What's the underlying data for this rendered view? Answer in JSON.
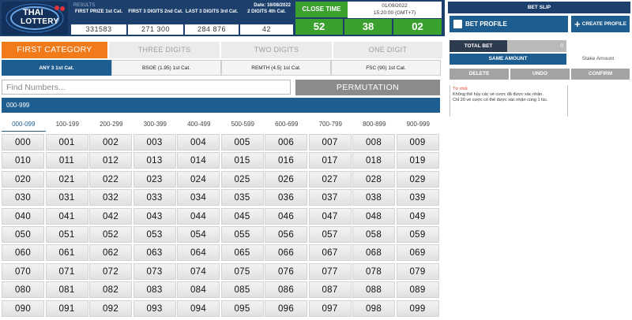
{
  "header": {
    "logo": {
      "line1": "THAI",
      "line2": "LOTTERY"
    },
    "results_label": "RESULTS",
    "results_date": "Date: 16/08/2022",
    "prizes": [
      {
        "title": "FIRST PRIZE 1st Cat.",
        "value": "331583"
      },
      {
        "title": "FIRST 3 DIGITS 2nd Cat.",
        "value": "271  300"
      },
      {
        "title": "LAST 3 DIGITS 3rd Cat.",
        "value": "284  876"
      },
      {
        "title": "2 DIGITS 4th Cat.",
        "value": "42"
      }
    ],
    "close_time": {
      "label": "CLOSE TIME",
      "date": "01/09/2022",
      "time": "15:20:00 (GMT+7)",
      "countdown": [
        "52",
        "38",
        "02"
      ]
    }
  },
  "category_tabs": [
    {
      "label": "FIRST CATEGORY",
      "active": true
    },
    {
      "label": "THREE DIGITS",
      "active": false
    },
    {
      "label": "TWO DIGITS",
      "active": false
    },
    {
      "label": "ONE DIGIT",
      "active": false
    }
  ],
  "sub_tabs": [
    {
      "label": "ANY 3 1st Cat.",
      "active": true
    },
    {
      "label": "BSOE (1.95) 1st Cat.",
      "active": false
    },
    {
      "label": "REMTH (4.5) 1st Cat.",
      "active": false
    },
    {
      "label": "FSC (90) 1st Cat.",
      "active": false
    }
  ],
  "search": {
    "placeholder": "Find Numbers...",
    "value": ""
  },
  "permutation_button": "PERMUTATION",
  "range_bar_label": "000-999",
  "range_tabs": [
    {
      "label": "000-099",
      "active": true
    },
    {
      "label": "100-199",
      "active": false
    },
    {
      "label": "200-299",
      "active": false
    },
    {
      "label": "300-399",
      "active": false
    },
    {
      "label": "400-499",
      "active": false
    },
    {
      "label": "500-599",
      "active": false
    },
    {
      "label": "600-699",
      "active": false
    },
    {
      "label": "700-799",
      "active": false
    },
    {
      "label": "800-899",
      "active": false
    },
    {
      "label": "900-999",
      "active": false
    }
  ],
  "numbers": [
    [
      "000",
      "001",
      "002",
      "003",
      "004",
      "005",
      "006",
      "007",
      "008",
      "009"
    ],
    [
      "010",
      "011",
      "012",
      "013",
      "014",
      "015",
      "016",
      "017",
      "018",
      "019"
    ],
    [
      "020",
      "021",
      "022",
      "023",
      "024",
      "025",
      "026",
      "027",
      "028",
      "029"
    ],
    [
      "030",
      "031",
      "032",
      "033",
      "034",
      "035",
      "036",
      "037",
      "038",
      "039"
    ],
    [
      "040",
      "041",
      "042",
      "043",
      "044",
      "045",
      "046",
      "047",
      "048",
      "049"
    ],
    [
      "050",
      "051",
      "052",
      "053",
      "054",
      "055",
      "056",
      "057",
      "058",
      "059"
    ],
    [
      "060",
      "061",
      "062",
      "063",
      "064",
      "065",
      "066",
      "067",
      "068",
      "069"
    ],
    [
      "070",
      "071",
      "072",
      "073",
      "074",
      "075",
      "076",
      "077",
      "078",
      "079"
    ],
    [
      "080",
      "081",
      "082",
      "083",
      "084",
      "085",
      "086",
      "087",
      "088",
      "089"
    ],
    [
      "090",
      "091",
      "092",
      "093",
      "094",
      "095",
      "096",
      "097",
      "098",
      "099"
    ]
  ],
  "bet_slip": {
    "title": "BET SLIP",
    "bet_profile_label": "BET PROFILE",
    "create_profile_label": "CREATE PROFILE",
    "total_bet_label": "TOTAL BET",
    "total_bet_value": "0",
    "same_amount_label": "SAME AMOUNT",
    "stake_amount_label": "Stake Amount",
    "delete_label": "DELETE",
    "undo_label": "UNDO",
    "confirm_label": "CONFIRM",
    "notice_title": "Từ chối",
    "notice_lines": [
      "Không thể hủy các vé cược đã được xác nhận.",
      "Chỉ 20 vé cược có thể được xác nhận cùng 1 lúc."
    ]
  },
  "colors": {
    "header_navy": "#1c3f6c",
    "accent_orange": "#f17a1b",
    "active_blue": "#1e5d8f",
    "countdown_green": "#3aa02e"
  }
}
